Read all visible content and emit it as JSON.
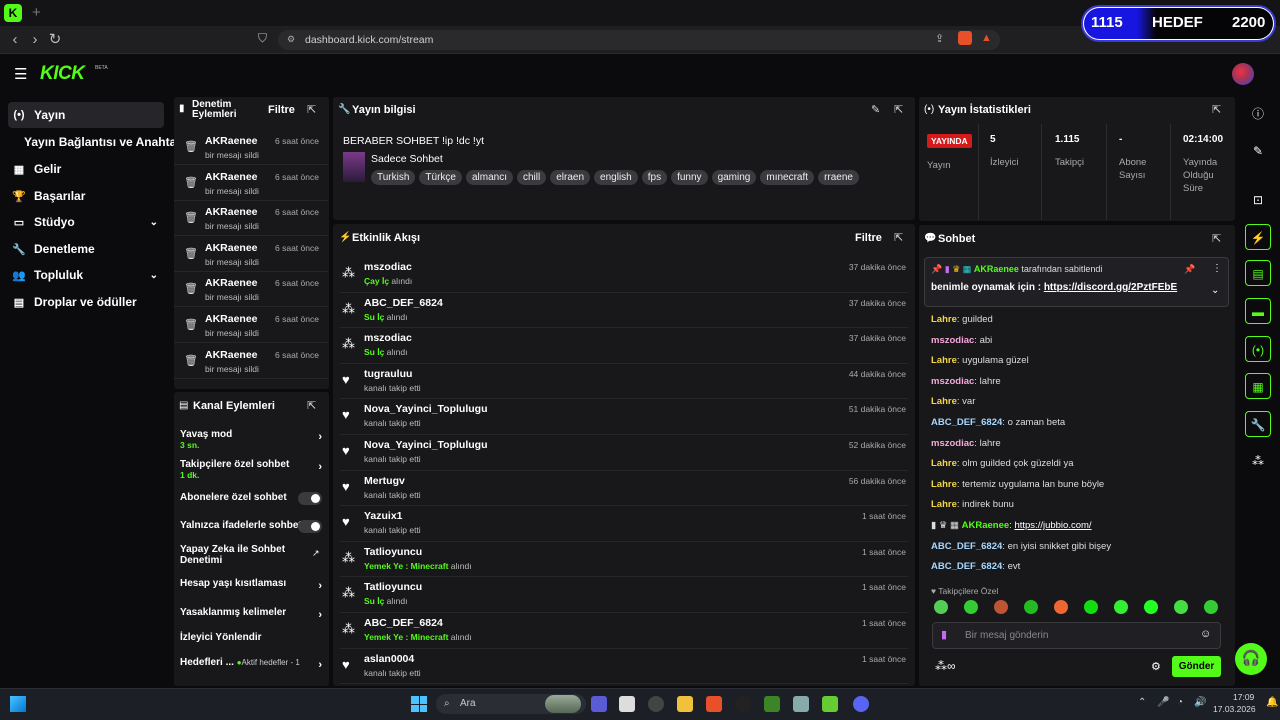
{
  "browser": {
    "url": "dashboard.kick.com/stream",
    "tab_favicon": "K",
    "new_tab": "+"
  },
  "goal": {
    "current": "1115",
    "label": "HEDEF",
    "target": "2200",
    "progress": 0.507
  },
  "app": {
    "logo": "KICK",
    "beta": "BETA"
  },
  "sidebar": {
    "items": [
      {
        "label": "Yayın",
        "icon": "broadcast-icon"
      },
      {
        "label": "Yayın Bağlantısı ve Anahtarı",
        "icon": ""
      },
      {
        "label": "Gelir",
        "icon": "revenue-icon"
      },
      {
        "label": "Başarılar",
        "icon": "trophy-icon"
      },
      {
        "label": "Stüdyo",
        "icon": "studio-icon"
      },
      {
        "label": "Denetleme",
        "icon": "wrench-icon"
      },
      {
        "label": "Topluluk",
        "icon": "community-icon"
      },
      {
        "label": "Droplar ve ödüller",
        "icon": "drops-icon"
      }
    ]
  },
  "moderation": {
    "title1": "Denetim",
    "title2": "Eylemleri",
    "filter": "Filtre",
    "rows": [
      {
        "name": "AKRaenee",
        "time": "6 saat önce",
        "action": "bir mesajı sildi"
      },
      {
        "name": "AKRaenee",
        "time": "6 saat önce",
        "action": "bir mesajı sildi"
      },
      {
        "name": "AKRaenee",
        "time": "6 saat önce",
        "action": "bir mesajı sildi"
      },
      {
        "name": "AKRaenee",
        "time": "6 saat önce",
        "action": "bir mesajı sildi"
      },
      {
        "name": "AKRaenee",
        "time": "6 saat önce",
        "action": "bir mesajı sildi"
      },
      {
        "name": "AKRaenee",
        "time": "6 saat önce",
        "action": "bir mesajı sildi"
      },
      {
        "name": "AKRaenee",
        "time": "6 saat önce",
        "action": "bir mesajı sildi"
      }
    ]
  },
  "channel_actions": {
    "title": "Kanal Eylemleri",
    "slow_mode": "Yavaş mod",
    "slow_value": "3 sn.",
    "follower_chat": "Takipçilere özel sohbet",
    "follower_value": "1 dk.",
    "sub_chat": "Abonelere özel sohbet",
    "emote_chat": "Yalnızca ifadelerle sohbet",
    "ai_chat": "Yapay Zeka ile Sohbet Denetimi",
    "age": "Hesap yaşı kısıtlaması",
    "banned_words": "Yasaklanmış kelimeler",
    "viewer_redirect": "İzleyici Yönlendir",
    "goals": "Hedefleri ...",
    "goals_status": "Aktif hedefler - 1"
  },
  "stream_info": {
    "title": "Yayın bilgisi",
    "stream_title": "BERABER SOHBET !ip !dc !yt",
    "category": "Sadece Sohbet",
    "tags": [
      "Turkish",
      "Türkçe",
      "almancı",
      "chill",
      "elraen",
      "english",
      "fps",
      "funny",
      "gaming",
      "mınecraft",
      "rraene"
    ]
  },
  "events": {
    "title": "Etkinlik Akışı",
    "filter": "Filtre",
    "rows": [
      {
        "icon": "reward",
        "name": "mszodiac",
        "reward": "Çay İç",
        "suffix": " alındı",
        "time": "37 dakika önce"
      },
      {
        "icon": "reward",
        "name": "ABC_DEF_6824",
        "reward": "Su İç",
        "suffix": " alındı",
        "time": "37 dakika önce"
      },
      {
        "icon": "reward",
        "name": "mszodiac",
        "reward": "Su İç",
        "suffix": " alındı",
        "time": "37 dakika önce"
      },
      {
        "icon": "heart",
        "name": "tugrauluu",
        "reward": "",
        "suffix": "kanalı takip etti",
        "time": "44 dakika önce"
      },
      {
        "icon": "heart",
        "name": "Nova_Yayinci_Toplulugu",
        "reward": "",
        "suffix": "kanalı takip etti",
        "time": "51 dakika önce"
      },
      {
        "icon": "heart",
        "name": "Nova_Yayinci_Toplulugu",
        "reward": "",
        "suffix": "kanalı takip etti",
        "time": "52 dakika önce"
      },
      {
        "icon": "heart",
        "name": "Mertugv",
        "reward": "",
        "suffix": "kanalı takip etti",
        "time": "56 dakika önce"
      },
      {
        "icon": "heart",
        "name": "Yazuix1",
        "reward": "",
        "suffix": "kanalı takip etti",
        "time": "1 saat önce"
      },
      {
        "icon": "reward",
        "name": "Tatlioyuncu",
        "reward": "Yemek Ye : Minecraft",
        "suffix": " alındı",
        "time": "1 saat önce"
      },
      {
        "icon": "reward",
        "name": "Tatlioyuncu",
        "reward": "Su İç",
        "suffix": " alındı",
        "time": "1 saat önce"
      },
      {
        "icon": "reward",
        "name": "ABC_DEF_6824",
        "reward": "Yemek Ye : Minecraft",
        "suffix": " alındı",
        "time": "1 saat önce"
      },
      {
        "icon": "heart",
        "name": "aslan0004",
        "reward": "",
        "suffix": "kanalı takip etti",
        "time": "1 saat önce"
      }
    ]
  },
  "stats": {
    "title": "Yayın İstatistikleri",
    "live": "YAYINDA",
    "live_label": "Yayın",
    "cols": [
      {
        "value": "5",
        "label": "İzleyici"
      },
      {
        "value": "1.115",
        "label": "Takipçi"
      },
      {
        "value": "-",
        "label": "Abone Sayısı"
      },
      {
        "value": "02:14:00",
        "label": "Yayında Olduğu Süre"
      }
    ]
  },
  "chat": {
    "title": "Sohbet",
    "pinned_by": "AKRaenee",
    "pinned_suffix": " tarafından sabitlendi",
    "pinned_text": "benimle oynamak için : ",
    "pinned_link": "https://discord.gg/2PztFEbE",
    "messages": [
      {
        "user": "Lahre",
        "color": "#f5d547",
        "text": "guilded"
      },
      {
        "user": "mszodiac",
        "color": "#f7a8d8",
        "text": "abi"
      },
      {
        "user": "Lahre",
        "color": "#f5d547",
        "text": "uygulama güzel"
      },
      {
        "user": "mszodiac",
        "color": "#f7a8d8",
        "text": "lahre"
      },
      {
        "user": "Lahre",
        "color": "#f5d547",
        "text": "var"
      },
      {
        "user": "ABC_DEF_6824",
        "color": "#a8d8ff",
        "text": "o zaman beta"
      },
      {
        "user": "mszodiac",
        "color": "#f7a8d8",
        "text": "lahre"
      },
      {
        "user": "Lahre",
        "color": "#f5d547",
        "text": "olm guilded çok güzeldi ya"
      },
      {
        "user": "Lahre",
        "color": "#f5d547",
        "text": "tertemiz uygulama lan bune böyle"
      },
      {
        "user": "Lahre",
        "color": "#f5d547",
        "text": "indirek bunu"
      },
      {
        "user": "AKRaenee",
        "color": "#53fc18",
        "text": "https://jubbio.com/"
      },
      {
        "user": "ABC_DEF_6824",
        "color": "#a8d8ff",
        "text": "en iyisi snikket gibi bişey"
      },
      {
        "user": "ABC_DEF_6824",
        "color": "#a8d8ff",
        "text": "evt"
      }
    ],
    "followers_only": "Takipçilere Özel",
    "placeholder": "Bir mesaj gönderin",
    "send": "Gönder"
  },
  "taskbar": {
    "search": "Ara",
    "time": "17:09",
    "date": "17.03.2026"
  }
}
